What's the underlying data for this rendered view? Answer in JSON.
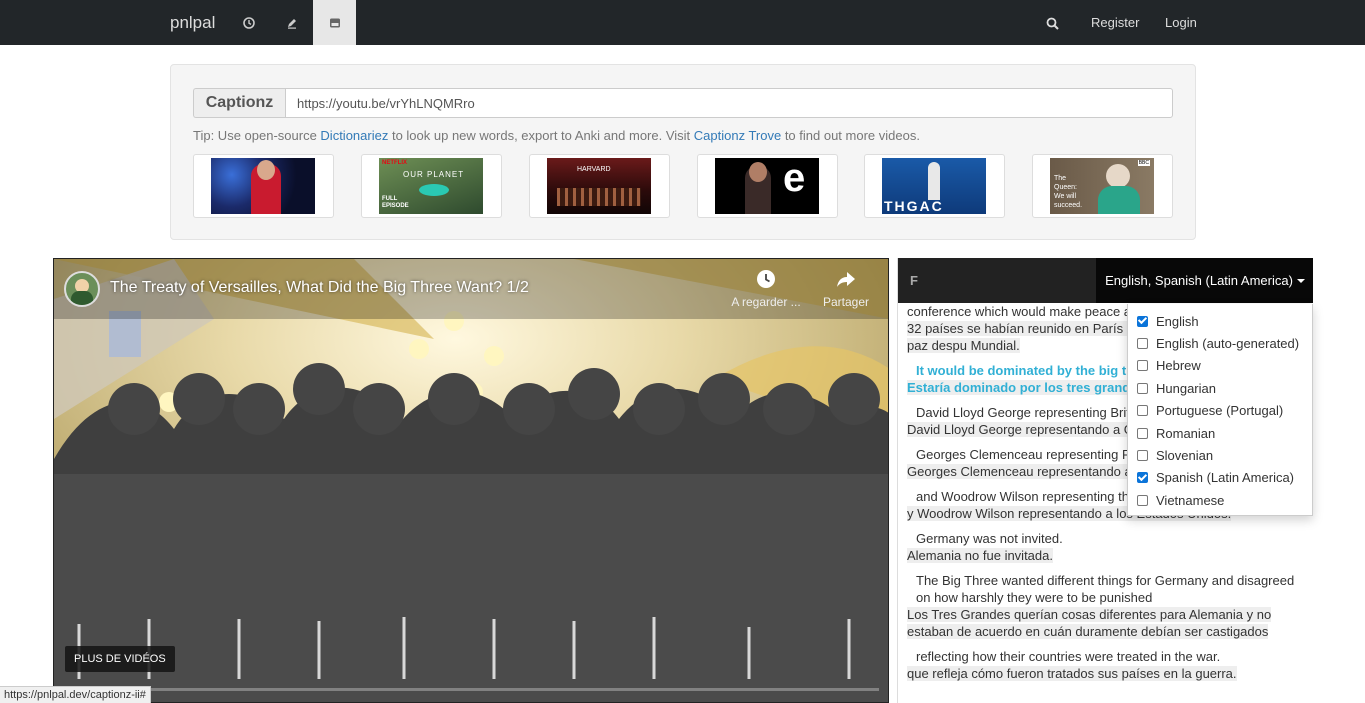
{
  "navbar": {
    "brand": "pnlpal",
    "icons": [
      "clock-icon",
      "pencil-icon",
      "youtube-icon"
    ],
    "search_icon": "search-icon",
    "register": "Register",
    "login": "Login"
  },
  "captionz": {
    "addon": "Captionz",
    "url": "https://youtu.be/vrYhLNQMRro",
    "tip_before": "Tip: Use open-source ",
    "tip_link1": "Dictionariez",
    "tip_middle": " to look up new words, export to Anki and more. Visit ",
    "tip_link2": "Captionz Trove",
    "tip_after": " to find out more videos.",
    "thumbnails": [
      {
        "id": "thumb-1",
        "overlay": ""
      },
      {
        "id": "thumb-2",
        "overlay": "OUR PLANET",
        "badge": "NETFLIX",
        "sub": "FULL EPISODE"
      },
      {
        "id": "thumb-3",
        "overlay": "HARVARD"
      },
      {
        "id": "thumb-4",
        "overlay": ""
      },
      {
        "id": "thumb-5",
        "overlay": "THGAC"
      },
      {
        "id": "thumb-6",
        "overlay": "The Queen: We will succeed.",
        "badge": "BBC"
      }
    ]
  },
  "video": {
    "title": "The Treaty of Versailles, What Did the Big Three Want? 1/2",
    "watch_later": "A regarder ...",
    "share": "Partager",
    "more_videos": "PLUS DE VIDÉOS",
    "progress": 0.01
  },
  "transcript": {
    "header_letter": "F",
    "languages_label": "English, Spanish (Latin America)",
    "lines": [
      {
        "en": "conference which would make peace af",
        "es": "32 países se habían reunido en París e una conferencia que haría la paz despu Mundial.",
        "highlight": false
      },
      {
        "en": "It would be dominated by the big th",
        "es": "Estaría dominado por los tres grande",
        "highlight": true
      },
      {
        "en": "David Lloyd George representing Brita",
        "es": "David Lloyd George representando a G",
        "highlight": false
      },
      {
        "en": "Georges Clemenceau representing Fr",
        "es": "Georges Clemenceau representando a",
        "highlight": false
      },
      {
        "en": "and Woodrow Wilson representing the USA.",
        "es": "y Woodrow Wilson representando a los Estados Unidos.",
        "highlight": false
      },
      {
        "en": "Germany was not invited.",
        "es": "Alemania no fue invitada.",
        "highlight": false
      },
      {
        "en": "The Big Three wanted different things for Germany and disagreed on how harshly they were to be punished",
        "es": "Los Tres Grandes querían cosas diferentes para Alemania y no estaban de acuerdo en cuán duramente debían ser castigados",
        "highlight": false
      },
      {
        "en": "reflecting how their countries were treated in the war.",
        "es": "que refleja cómo fueron tratados sus países en la guerra.",
        "highlight": false
      }
    ]
  },
  "language_dropdown": {
    "options": [
      {
        "label": "English",
        "checked": true
      },
      {
        "label": "English (auto-generated)",
        "checked": false
      },
      {
        "label": "Hebrew",
        "checked": false
      },
      {
        "label": "Hungarian",
        "checked": false
      },
      {
        "label": "Portuguese (Portugal)",
        "checked": false
      },
      {
        "label": "Romanian",
        "checked": false
      },
      {
        "label": "Slovenian",
        "checked": false
      },
      {
        "label": "Spanish (Latin America)",
        "checked": true
      },
      {
        "label": "Vietnamese",
        "checked": false
      }
    ]
  },
  "status_bar": {
    "url": "https://pnlpal.dev/captionz-ii#"
  },
  "colors": {
    "navbar": "#222629",
    "link": "#337ab7",
    "highlight": "#31b0d5",
    "progress": "#ff0000"
  }
}
